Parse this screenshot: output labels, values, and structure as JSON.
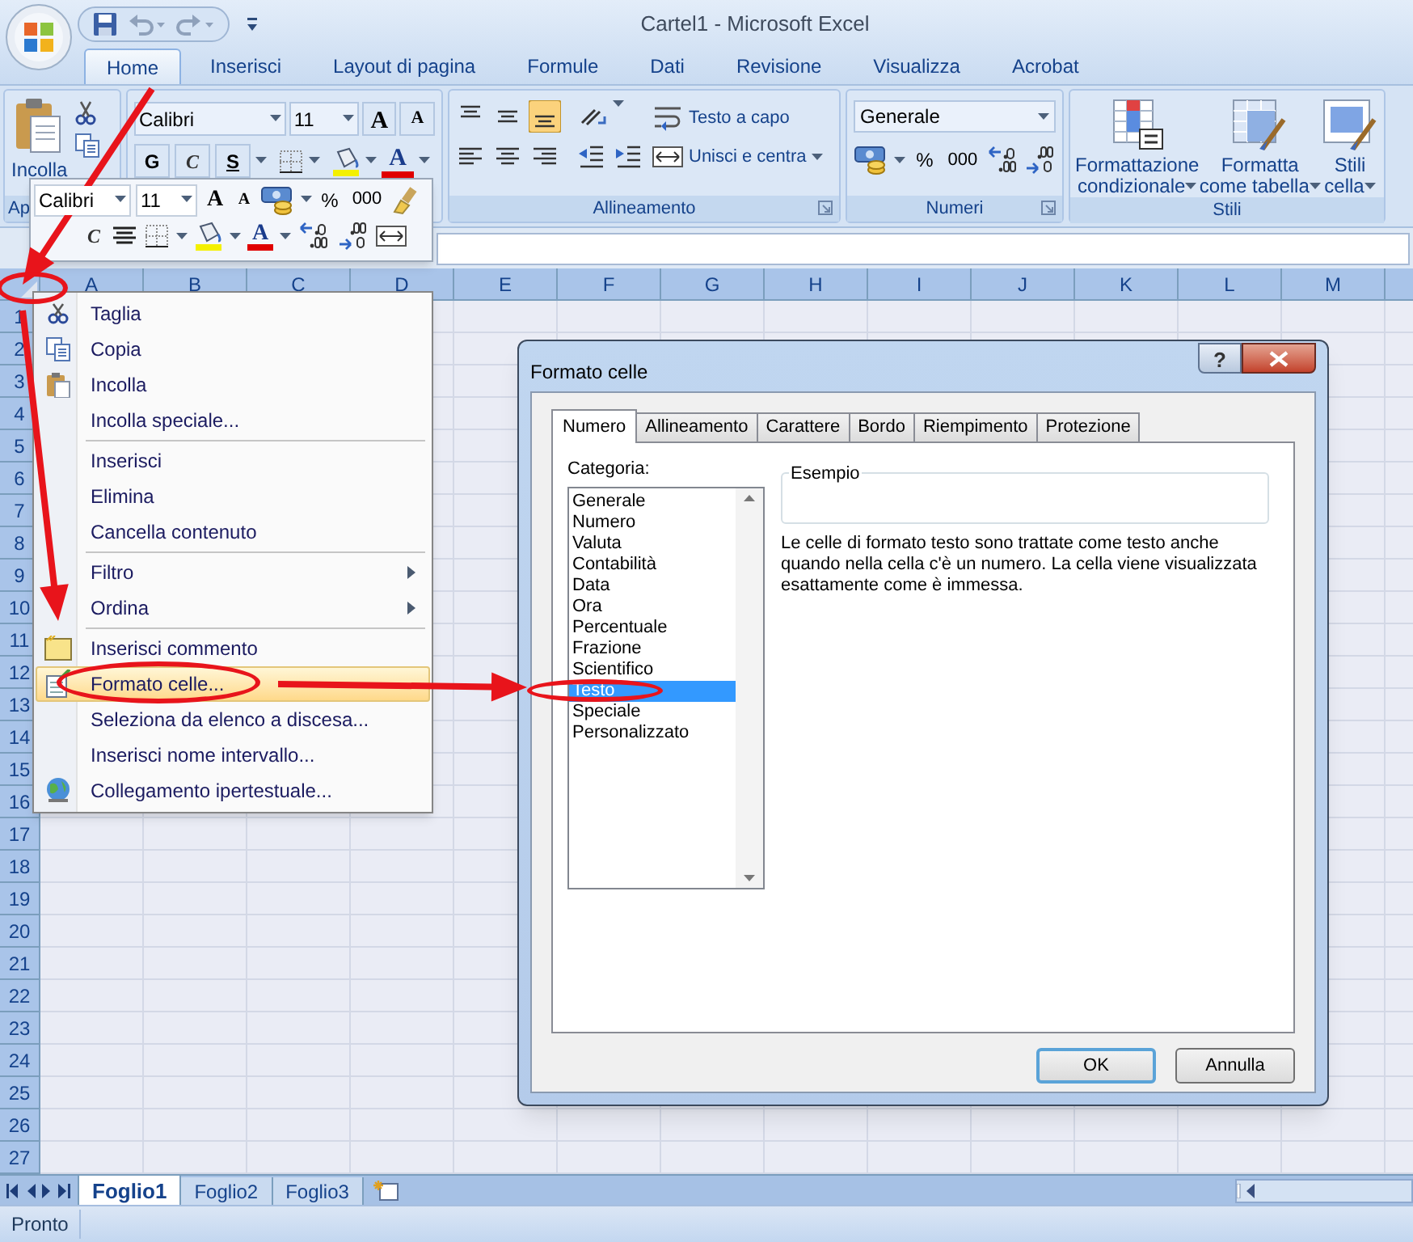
{
  "window": {
    "title": "Cartel1 - Microsoft Excel"
  },
  "ribbon_tabs": [
    {
      "label": "Home",
      "selected": true
    },
    {
      "label": "Inserisci",
      "selected": false
    },
    {
      "label": "Layout di pagina",
      "selected": false
    },
    {
      "label": "Formule",
      "selected": false
    },
    {
      "label": "Dati",
      "selected": false
    },
    {
      "label": "Revisione",
      "selected": false
    },
    {
      "label": "Visualizza",
      "selected": false
    },
    {
      "label": "Acrobat",
      "selected": false
    }
  ],
  "ribbon": {
    "clipboard": {
      "paste": "Incolla",
      "group_label": "Ap"
    },
    "font": {
      "font_name": "Calibri",
      "font_size": "11",
      "grow_font": "A",
      "shrink_font": "A",
      "bold": "G",
      "italic": "C",
      "underline": "S",
      "font_color": "A"
    },
    "alignment": {
      "wrap_text": "Testo a capo",
      "merge": "Unisci e centra",
      "group_label": "Allineamento"
    },
    "number": {
      "format": "Generale",
      "percent": "%",
      "thousands": "000",
      "group_label": "Numeri"
    },
    "styles": {
      "conditional_1": "Formattazione",
      "conditional_2": "condizionale",
      "table_1": "Formatta",
      "table_2": "come tabella",
      "cell_1": "Stili",
      "cell_2": "cella",
      "group_label": "Stili"
    }
  },
  "mini_toolbar": {
    "font_name": "Calibri",
    "font_size": "11",
    "grow_font": "A",
    "shrink_font": "A",
    "percent": "%",
    "thousands": "000",
    "italic": "C",
    "font_color": "A"
  },
  "columns": [
    "A",
    "B",
    "C",
    "D",
    "E",
    "F",
    "G",
    "H",
    "I",
    "J",
    "K",
    "L",
    "M"
  ],
  "rows": [
    "1",
    "2",
    "3",
    "4",
    "5",
    "6",
    "7",
    "8",
    "9",
    "10",
    "11",
    "12",
    "13",
    "14",
    "15",
    "16",
    "17",
    "18",
    "19",
    "20",
    "21",
    "22",
    "23",
    "24",
    "25",
    "26",
    "27"
  ],
  "context_menu": {
    "items": [
      {
        "label": "Taglia",
        "highlighted": false,
        "submenu": false,
        "separator_before": false
      },
      {
        "label": "Copia",
        "highlighted": false,
        "submenu": false,
        "separator_before": false
      },
      {
        "label": "Incolla",
        "highlighted": false,
        "submenu": false,
        "separator_before": false
      },
      {
        "label": "Incolla speciale...",
        "highlighted": false,
        "submenu": false,
        "separator_before": false
      },
      {
        "label": "Inserisci",
        "highlighted": false,
        "submenu": false,
        "separator_before": true
      },
      {
        "label": "Elimina",
        "highlighted": false,
        "submenu": false,
        "separator_before": false
      },
      {
        "label": "Cancella contenuto",
        "highlighted": false,
        "submenu": false,
        "separator_before": false
      },
      {
        "label": "Filtro",
        "highlighted": false,
        "submenu": true,
        "separator_before": true
      },
      {
        "label": "Ordina",
        "highlighted": false,
        "submenu": true,
        "separator_before": false
      },
      {
        "label": "Inserisci commento",
        "highlighted": false,
        "submenu": false,
        "separator_before": true
      },
      {
        "label": "Formato celle...",
        "highlighted": true,
        "submenu": false,
        "separator_before": false
      },
      {
        "label": "Seleziona da elenco a discesa...",
        "highlighted": false,
        "submenu": false,
        "separator_before": false
      },
      {
        "label": "Inserisci nome intervallo...",
        "highlighted": false,
        "submenu": false,
        "separator_before": false
      },
      {
        "label": "Collegamento ipertestuale...",
        "highlighted": false,
        "submenu": false,
        "separator_before": false
      }
    ]
  },
  "dialog": {
    "title": "Formato celle",
    "help": "?",
    "tabs": [
      {
        "label": "Numero",
        "selected": true
      },
      {
        "label": "Allineamento",
        "selected": false
      },
      {
        "label": "Carattere",
        "selected": false
      },
      {
        "label": "Bordo",
        "selected": false
      },
      {
        "label": "Riempimento",
        "selected": false
      },
      {
        "label": "Protezione",
        "selected": false
      }
    ],
    "category_label": "Categoria:",
    "categories": [
      {
        "label": "Generale",
        "selected": false
      },
      {
        "label": "Numero",
        "selected": false
      },
      {
        "label": "Valuta",
        "selected": false
      },
      {
        "label": "Contabilità",
        "selected": false
      },
      {
        "label": "Data",
        "selected": false
      },
      {
        "label": "Ora",
        "selected": false
      },
      {
        "label": "Percentuale",
        "selected": false
      },
      {
        "label": "Frazione",
        "selected": false
      },
      {
        "label": "Scientifico",
        "selected": false
      },
      {
        "label": "Testo",
        "selected": true
      },
      {
        "label": "Speciale",
        "selected": false
      },
      {
        "label": "Personalizzato",
        "selected": false
      }
    ],
    "sample_label": "Esempio",
    "description": "Le celle di formato testo sono trattate come testo anche quando nella cella c'è un numero. La cella viene visualizzata esattamente come è immessa.",
    "buttons": [
      "OK",
      "Annulla"
    ]
  },
  "sheet_tabs": [
    {
      "label": "Foglio1",
      "selected": true
    },
    {
      "label": "Foglio2",
      "selected": false
    },
    {
      "label": "Foglio3",
      "selected": false
    }
  ],
  "status_bar": {
    "text": "Pronto"
  }
}
